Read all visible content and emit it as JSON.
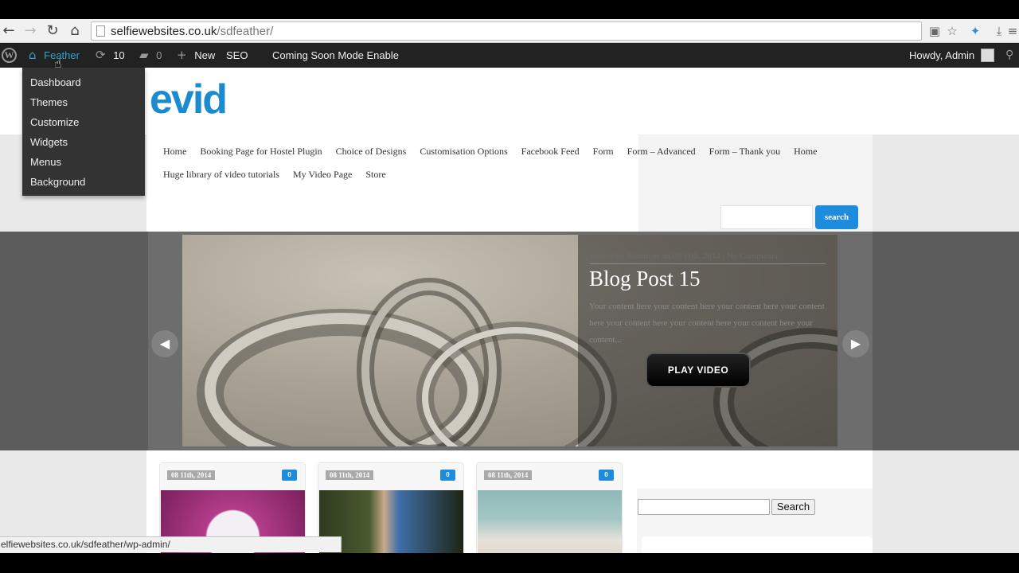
{
  "browser": {
    "url_host": "selfiewebsites.co.uk",
    "url_path": "/sdfeather/",
    "status_url": "elfiewebsites.co.uk/sdfeather/wp-admin/"
  },
  "adminbar": {
    "site_name": "Feather",
    "updates_count": "10",
    "comments_count": "0",
    "new_label": "New",
    "seo_label": "SEO",
    "coming_soon_label": "Coming Soon Mode Enable",
    "howdy": "Howdy, Admin"
  },
  "dropdown": {
    "items": [
      "Dashboard",
      "Themes",
      "Customize",
      "Widgets",
      "Menus",
      "Background"
    ]
  },
  "site": {
    "logo_text": "evid",
    "menu": [
      "Home",
      "Booking Page for Hostel Plugin",
      "Choice of Designs",
      "Customisation Options",
      "Facebook Feed",
      "Form",
      "Form – Advanced",
      "Form – Thank you",
      "Home",
      "Huge library of video tutorials",
      "My Video Page",
      "Store"
    ],
    "search_button": "search"
  },
  "slide": {
    "meta": "Posted by Admin in on 08 11th, 2014 | No Comments",
    "title": "Blog Post 15",
    "excerpt": "Your content here your content here your content here your content here your content here your content here your content here your content...",
    "play_label": "PLAY VIDEO"
  },
  "cards": [
    {
      "date": "08 11th, 2014",
      "comments": "0"
    },
    {
      "date": "08 11th, 2014",
      "comments": "0"
    },
    {
      "date": "08 11th, 2014",
      "comments": "0"
    }
  ],
  "sidebar": {
    "search_button": "Search"
  },
  "colors": {
    "accent": "#1e8cdc",
    "adminbar": "#222222",
    "highlight": "#2ea2cc"
  }
}
